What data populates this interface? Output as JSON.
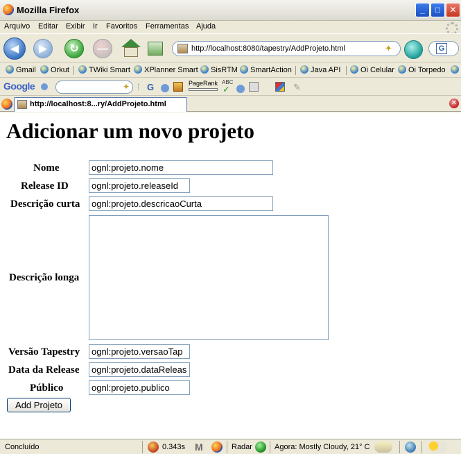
{
  "window": {
    "title": "Mozilla Firefox"
  },
  "menu": [
    "Arquivo",
    "Editar",
    "Exibir",
    "Ir",
    "Favoritos",
    "Ferramentas",
    "Ajuda"
  ],
  "address": {
    "url": "http://localhost:8080/tapestry/AddProjeto.html"
  },
  "bookmarks": [
    "Gmail",
    "Orkut",
    "TWiki Smart",
    "XPlanner Smart",
    "SisRTM",
    "SmartAction",
    "Java API",
    "Oi Celular",
    "Oi Torpedo"
  ],
  "google_toolbar": {
    "logo": "Google",
    "pagerank_label": "PageRank",
    "spell_label": "ABC"
  },
  "tab": {
    "label": "http://localhost:8...ry/AddProjeto.html"
  },
  "page": {
    "heading": "Adicionar um novo projeto",
    "fields": {
      "nome": {
        "label": "Nome",
        "value": "ognl:projeto.nome"
      },
      "release_id": {
        "label": "Release ID",
        "value": "ognl:projeto.releaseId"
      },
      "descricao_curta": {
        "label": "Descrição curta",
        "value": "ognl:projeto.descricaoCurta"
      },
      "descricao_longa": {
        "label": "Descrição longa",
        "value": ""
      },
      "versao_tapestry": {
        "label": "Versão Tapestry",
        "value": "ognl:projeto.versaoTap"
      },
      "data_release": {
        "label": "Data da Release",
        "value": "ognl:projeto.dataReleas"
      },
      "publico": {
        "label": "Público",
        "value": "ognl:projeto.publico"
      }
    },
    "submit_label": "Add Projeto"
  },
  "status": {
    "text": "Concluído",
    "timing": "0.343s",
    "radar": "Radar",
    "weather": "Agora: Mostly Cloudy, 21° C"
  }
}
